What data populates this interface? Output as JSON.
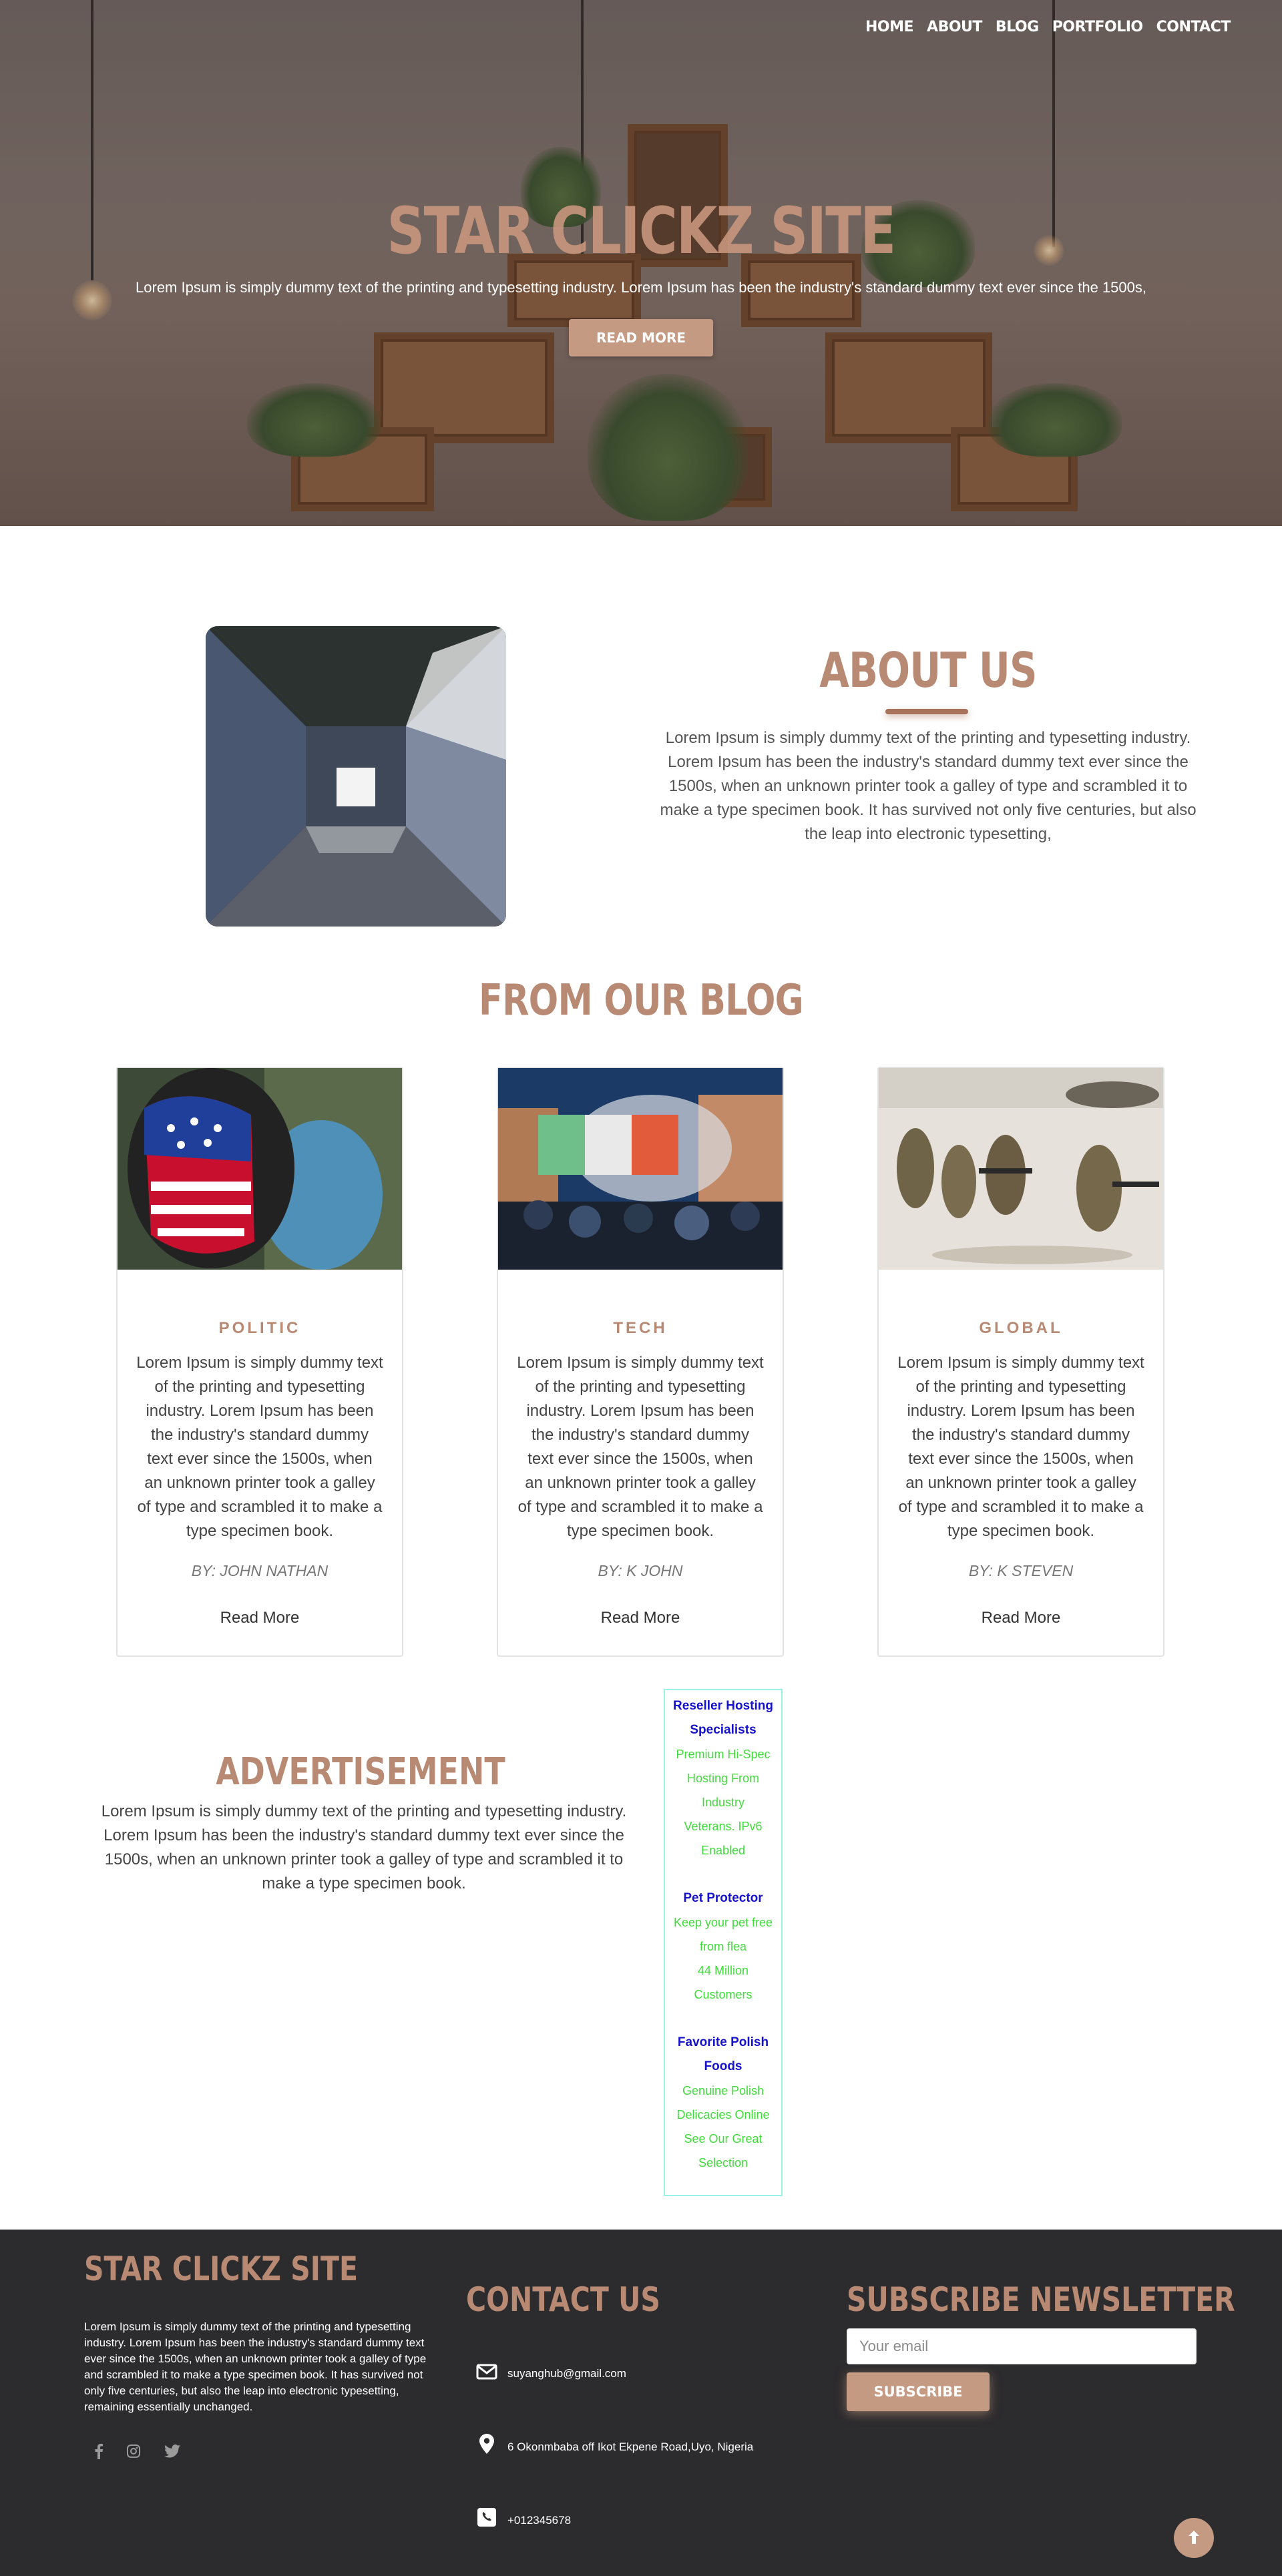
{
  "nav": {
    "items": [
      "HOME",
      "ABOUT",
      "BLOG",
      "PORTFOLIO",
      "CONTACT"
    ]
  },
  "hero": {
    "title": "STAR CLICKZ SITE",
    "subtitle": "Lorem Ipsum is simply dummy text of the printing and typesetting industry. Lorem Ipsum has been the industry's standard dummy text ever since the 1500s,",
    "button_label": "READ MORE"
  },
  "about": {
    "title": "ABOUT US",
    "text": "Lorem Ipsum is simply dummy text of the printing and typesetting industry. Lorem Ipsum has been the industry's standard dummy text ever since the 1500s, when an unknown printer took a galley of type and scrambled it to make a type specimen book. It has survived not only five centuries, but also the leap into electronic typesetting,"
  },
  "blog": {
    "heading": "FROM OUR BLOG",
    "posts": [
      {
        "category": "POLITIC",
        "text": "Lorem Ipsum is simply dummy text of the printing and typesetting industry. Lorem Ipsum has been the industry's standard dummy text ever since the 1500s, when an unknown printer took a galley of type and scrambled it to make a type specimen book.",
        "author": "BY: JOHN NATHAN",
        "read_more": "Read More"
      },
      {
        "category": "TECH",
        "text": "Lorem Ipsum is simply dummy text of the printing and typesetting industry. Lorem Ipsum has been the industry's standard dummy text ever since the 1500s, when an unknown printer took a galley of type and scrambled it to make a type specimen book.",
        "author": "BY: K JOHN",
        "read_more": "Read More"
      },
      {
        "category": "GLOBAL",
        "text": "Lorem Ipsum is simply dummy text of the printing and typesetting industry. Lorem Ipsum has been the industry's standard dummy text ever since the 1500s, when an unknown printer took a galley of type and scrambled it to make a type specimen book.",
        "author": "BY: K STEVEN",
        "read_more": "Read More"
      }
    ]
  },
  "advertisement": {
    "title": "ADVERTISEMENT",
    "text": "Lorem Ipsum is simply dummy text of the printing and typesetting industry. Lorem Ipsum has been the industry's standard dummy text ever since the 1500s, when an unknown printer took a galley of type and scrambled it to make a type specimen book.",
    "ads": [
      {
        "head_1": "Reseller Hosting",
        "head_2": "Specialists",
        "lines": [
          "Premium Hi-Spec",
          "Hosting From",
          "Industry",
          "Veterans. IPv6",
          "Enabled"
        ]
      },
      {
        "head_1": "Pet Protector",
        "head_2": "",
        "lines": [
          "Keep your pet free",
          "from flea",
          "44 Million",
          "Customers"
        ]
      },
      {
        "head_1": "Favorite Polish",
        "head_2": "Foods",
        "lines": [
          "Genuine Polish",
          "Delicacies Online",
          "See Our Great",
          "Selection"
        ]
      }
    ]
  },
  "footer": {
    "site_title": "STAR CLICKZ SITE",
    "about_text": "Lorem Ipsum is simply dummy text of the printing and typesetting industry. Lorem Ipsum has been the industry's standard dummy text ever since the 1500s, when an unknown printer took a galley of type and scrambled it to make a type specimen book. It has survived not only five centuries, but also the leap into electronic typesetting, remaining essentially unchanged.",
    "social_icons": [
      "facebook-icon",
      "instagram-icon",
      "twitter-icon"
    ],
    "contact_title": "CONTACT US",
    "email": "suyanghub@gmail.com",
    "address": "6 Okonmbaba off Ikot Ekpene Road,Uyo, Nigeria",
    "phone": "+012345678",
    "newsletter_title": "SUBSCRIBE NEWSLETTER",
    "email_placeholder": "Your email",
    "subscribe_label": "SUBSCRIBE"
  },
  "colors": {
    "accent": "#b88a74",
    "button": "#c49a83",
    "footer_bg": "#2c2b2d",
    "ad_link": "#1511cc",
    "ad_text": "#3fdc3a"
  }
}
